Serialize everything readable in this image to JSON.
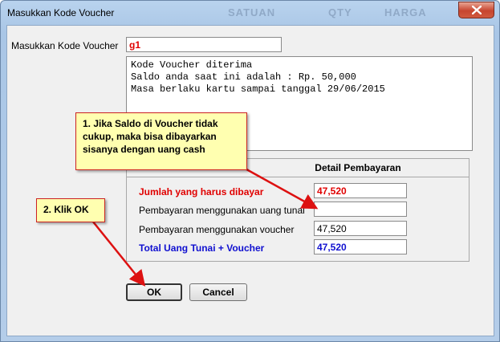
{
  "window": {
    "title": "Masukkan Kode Voucher",
    "background_headers": [
      "SATUAN",
      "QTY",
      "HARGA"
    ]
  },
  "form": {
    "voucher_label": "Masukkan Kode Voucher",
    "voucher_value": "g1",
    "message_lines": [
      "Kode Voucher diterima",
      "Saldo anda saat ini adalah : Rp. 50,000",
      "Masa berlaku kartu sampai tanggal 29/06/2015"
    ]
  },
  "payment": {
    "group_title": "Detail Pembayaran",
    "total_due_label": "Jumlah yang harus dibayar",
    "total_due_value": "47,520",
    "cash_label": "Pembayaran menggunakan uang tunai",
    "cash_value": "",
    "voucher_pay_label": "Pembayaran menggunakan voucher",
    "voucher_pay_value": "47,520",
    "grand_total_label": "Total Uang Tunai + Voucher",
    "grand_total_value": "47,520"
  },
  "buttons": {
    "ok_label": "OK",
    "cancel_label": "Cancel"
  },
  "annotations": {
    "callout1": "1. Jika Saldo di Voucher tidak cukup, maka bisa dibayarkan sisanya dengan uang cash",
    "callout2": "2. Klik OK"
  },
  "colors": {
    "callout_bg": "#ffffb0",
    "arrow": "#dd1111",
    "label_red": "#e00000",
    "label_blue": "#1010d0"
  }
}
